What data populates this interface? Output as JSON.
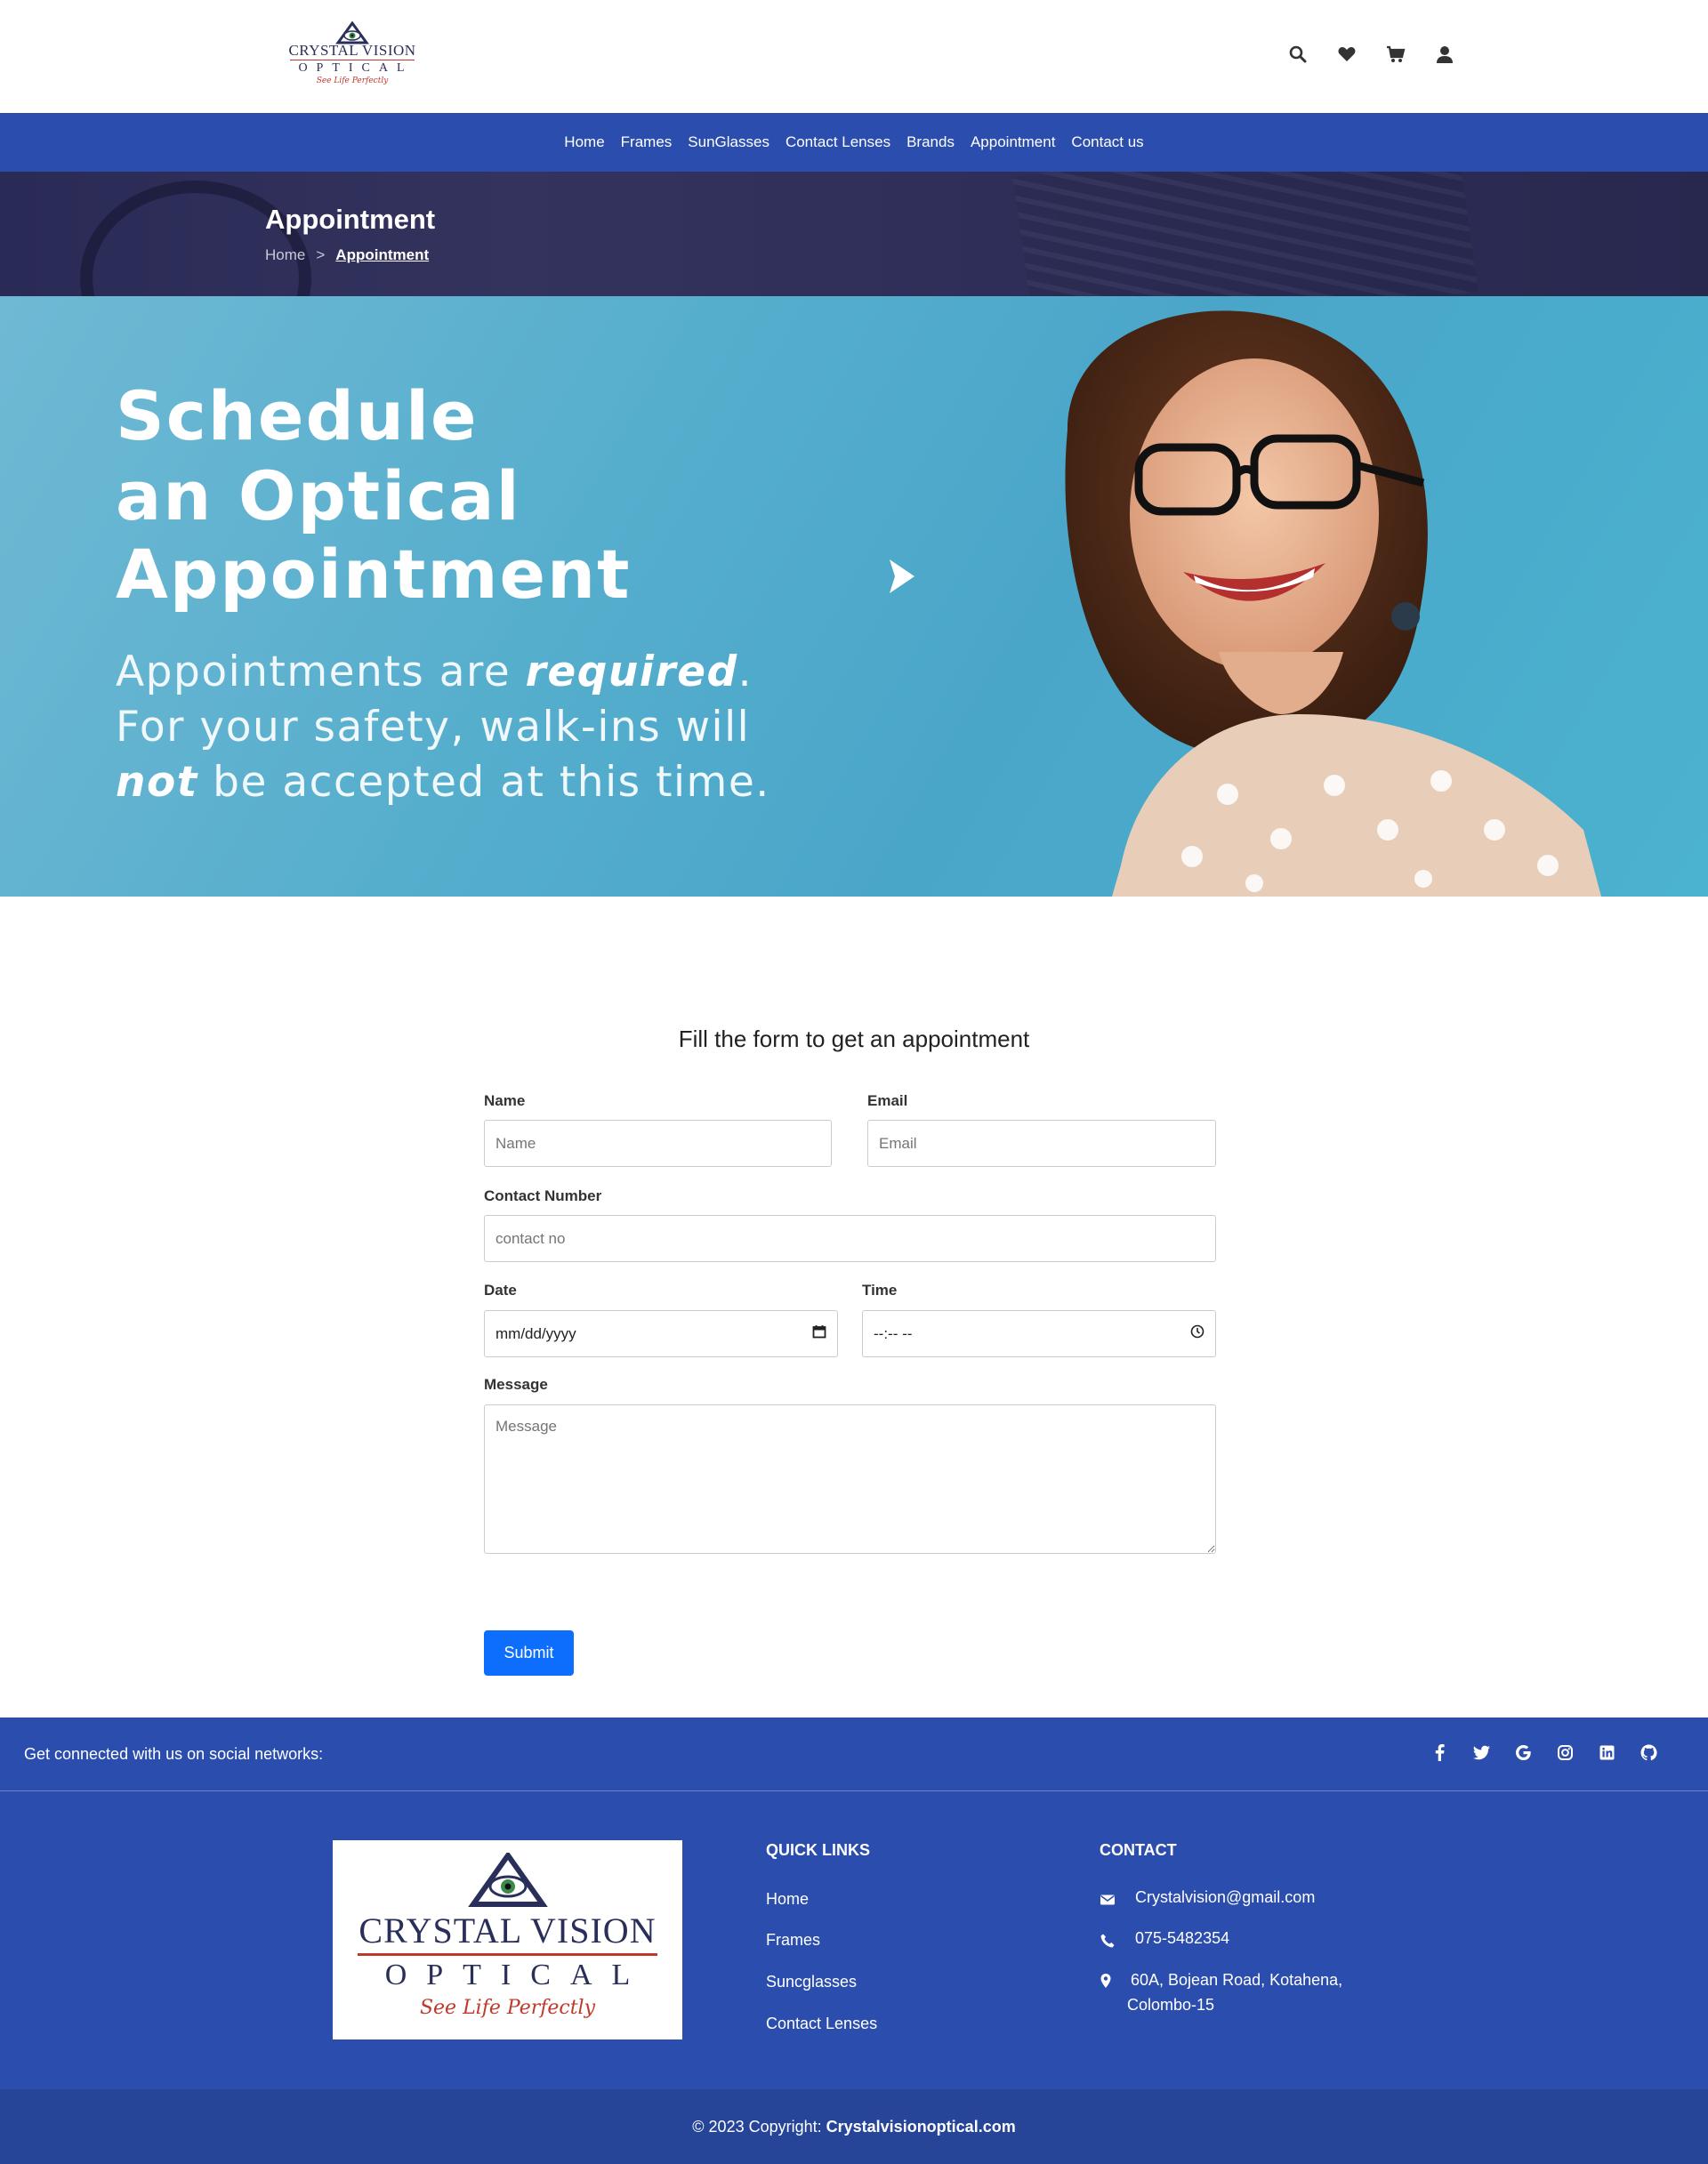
{
  "header": {
    "logo": {
      "line1": "CRYSTAL VISION",
      "line2": "OPTICAL",
      "tagline": "See Life Perfectly"
    },
    "icons": [
      "search-icon",
      "heart-icon",
      "cart-icon",
      "user-icon"
    ]
  },
  "nav": {
    "items": [
      {
        "label": "Home"
      },
      {
        "label": "Frames"
      },
      {
        "label": "SunGlasses"
      },
      {
        "label": "Contact Lenses"
      },
      {
        "label": "Brands"
      },
      {
        "label": "Appointment"
      },
      {
        "label": "Contact us"
      }
    ]
  },
  "page_title": {
    "title": "Appointment",
    "breadcrumb": {
      "home": "Home",
      "separator": ">",
      "current": "Appointment"
    }
  },
  "hero": {
    "line1": "Schedule",
    "line2": "an Optical",
    "line3": "Appointment",
    "sub1_pre": "Appointments are ",
    "sub1_em": "required",
    "sub1_post": ".",
    "sub2": "For your safety, walk-ins will",
    "sub3_em": "not",
    "sub3_post": " be accepted at this time."
  },
  "form": {
    "title": "Fill the form to get an appointment",
    "name_label": "Name",
    "name_placeholder": "Name",
    "email_label": "Email",
    "email_placeholder": "Email",
    "contact_label": "Contact Number",
    "contact_placeholder": "contact no",
    "date_label": "Date",
    "date_value": "mm/dd/yyyy",
    "time_label": "Time",
    "time_value": "--:-- --",
    "message_label": "Message",
    "message_placeholder": "Message",
    "submit_label": "Submit"
  },
  "footer": {
    "social_text": "Get connected with us on social networks:",
    "social_icons": [
      "facebook-icon",
      "twitter-icon",
      "google-icon",
      "instagram-icon",
      "linkedin-icon",
      "github-icon"
    ],
    "logo": {
      "line1": "CRYSTAL VISION",
      "line2": "OPTICAL",
      "tagline": "See Life Perfectly"
    },
    "quick_links_title": "QUICK LINKS",
    "quick_links": [
      {
        "label": "Home"
      },
      {
        "label": "Frames"
      },
      {
        "label": "Suncglasses"
      },
      {
        "label": "Contact Lenses"
      }
    ],
    "contact_title": "CONTACT",
    "email": "Crystalvision@gmail.com",
    "phone": "075-5482354",
    "address_line1": "60A, Bojean Road, Kotahena,",
    "address_line2": "Colombo-15",
    "copyright_pre": "© 2023 Copyright: ",
    "copyright_site": "Crystalvisionoptical.com"
  },
  "colors": {
    "brand_blue": "#2b4dae",
    "title_bar": "#2e2e58",
    "submit_blue": "#0d6efd",
    "logo_navy": "#2a2f5a",
    "logo_red": "#c0392b"
  }
}
